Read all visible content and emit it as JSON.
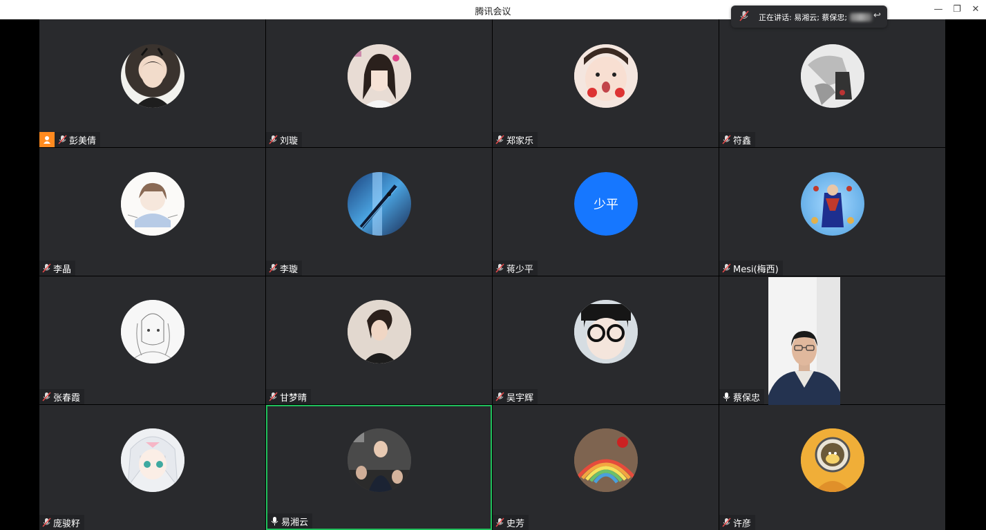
{
  "window": {
    "title": "腾讯会议",
    "controls": {
      "minimize": "—",
      "restore": "❐",
      "close": "✕"
    }
  },
  "speaking_indicator": {
    "text": "正在讲话: 易湘云; 蔡保忠;"
  },
  "participants": [
    {
      "name": "彭美倩",
      "muted": true,
      "host": true,
      "avatar": "photo-young-man"
    },
    {
      "name": "刘璇",
      "muted": true,
      "avatar": "photo-girl"
    },
    {
      "name": "郑家乐",
      "muted": true,
      "avatar": "photo-child"
    },
    {
      "name": "符鑫",
      "muted": true,
      "avatar": "photo-figure"
    },
    {
      "name": "李晶",
      "muted": true,
      "avatar": "illustration-girl"
    },
    {
      "name": "李璇",
      "muted": true,
      "avatar": "photo-stairs-blue"
    },
    {
      "name": "蒋少平",
      "muted": true,
      "avatar_text": "少平",
      "avatar_color": "#1677ff"
    },
    {
      "name": "Mesi(梅西)",
      "muted": true,
      "avatar": "religious-painting"
    },
    {
      "name": "张春霞",
      "muted": true,
      "avatar": "sketch-girl"
    },
    {
      "name": "甘梦晴",
      "muted": true,
      "avatar": "photo-woman"
    },
    {
      "name": "吴宇辉",
      "muted": true,
      "avatar": "photo-glasses-child"
    },
    {
      "name": "蔡保忠",
      "muted": false,
      "avatar": "camera-video",
      "speaking": true
    },
    {
      "name": "庞骏籽",
      "muted": true,
      "avatar": "anime-girl"
    },
    {
      "name": "易湘云",
      "muted": false,
      "avatar": "photo-crowd",
      "speaking": true,
      "active_border": "#20c05c"
    },
    {
      "name": "史芳",
      "muted": true,
      "avatar": "rainbow-art"
    },
    {
      "name": "许彦",
      "muted": true,
      "avatar": "cartoon-porthole"
    }
  ]
}
